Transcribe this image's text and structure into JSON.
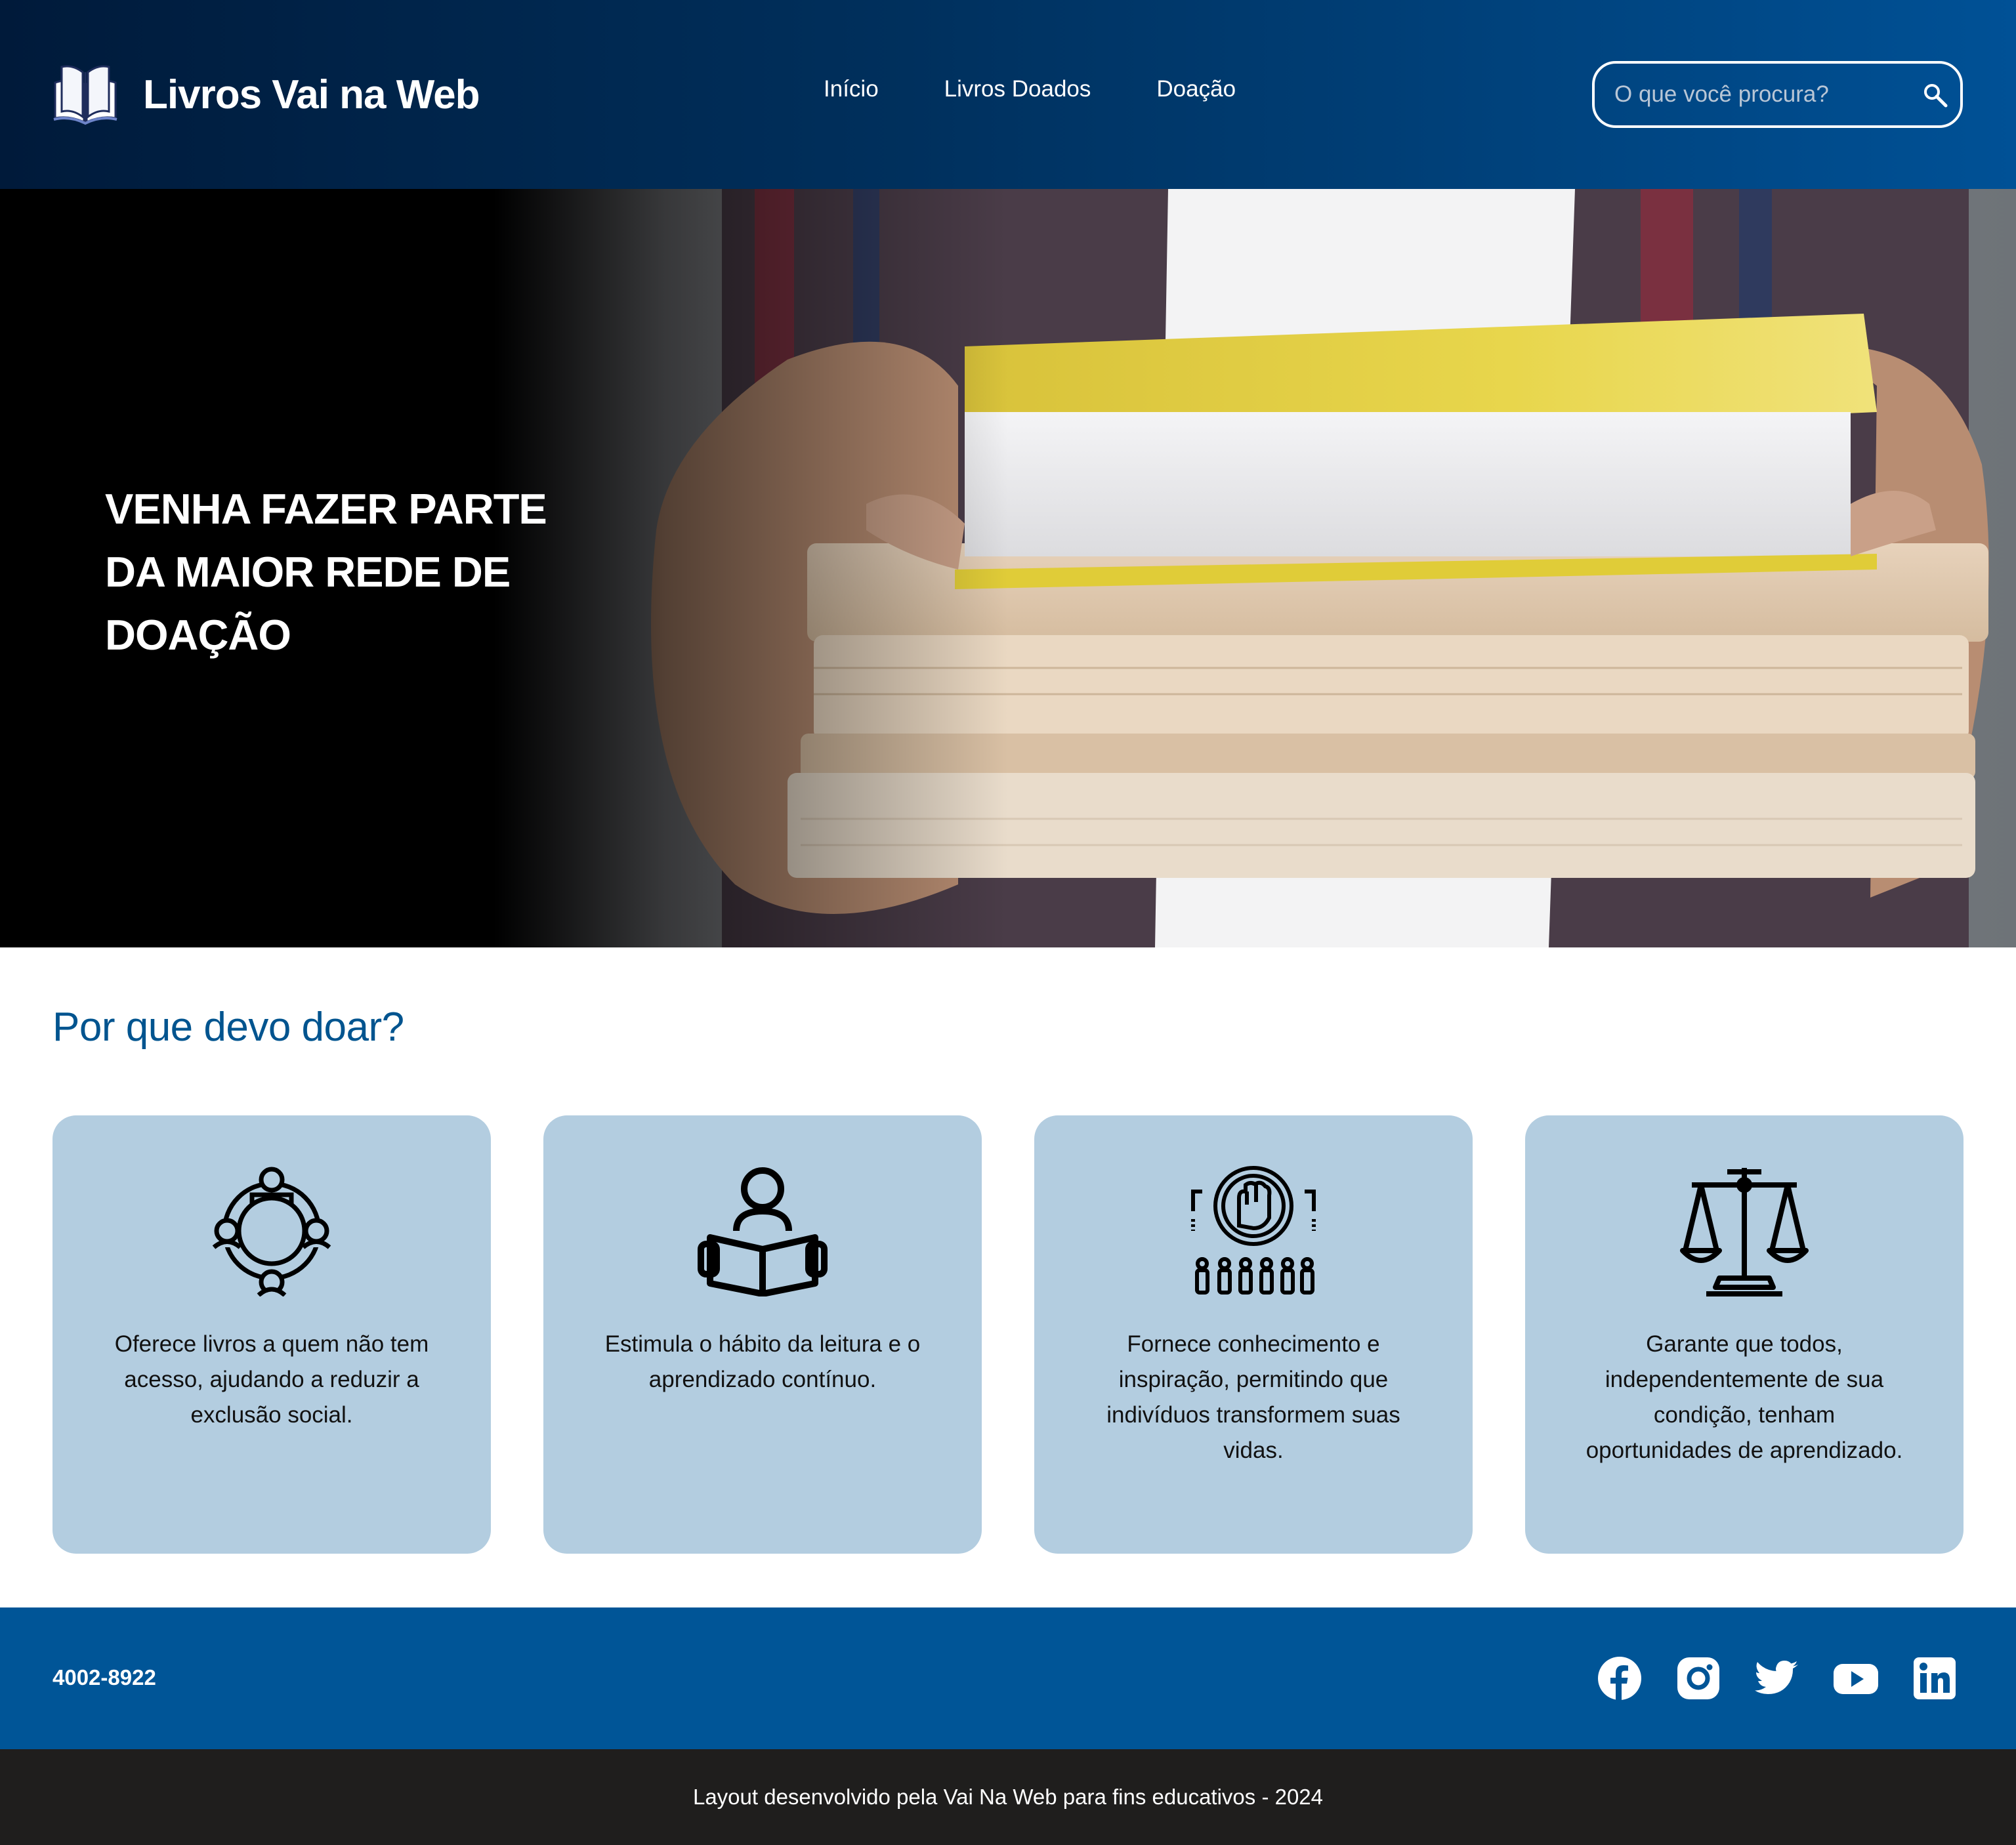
{
  "header": {
    "brand": "Livros Vai na Web",
    "nav": [
      "Início",
      "Livros Doados",
      "Doação"
    ],
    "search_placeholder": "O que você procura?"
  },
  "hero": {
    "line1": "VENHA FAZER PARTE",
    "line2": "DA MAIOR REDE DE",
    "line3": "DOAÇÃO"
  },
  "why": {
    "title": "Por que devo doar?",
    "cards": [
      {
        "icon": "community-circle-icon",
        "text": "Oferece livros a quem não tem acesso, ajudando a reduzir a exclusão social."
      },
      {
        "icon": "reader-book-icon",
        "text": "Estimula o hábito da leitura e o aprendizado contínuo."
      },
      {
        "icon": "raised-fist-people-icon",
        "text": "Fornece conhecimento e inspiração, permitindo que indivíduos transformem suas vidas."
      },
      {
        "icon": "justice-scale-icon",
        "text": "Garante que todos, independentemente de sua condição, tenham oportunidades de aprendizado."
      }
    ]
  },
  "footer": {
    "phone": "4002-8922",
    "socials": [
      "facebook-icon",
      "instagram-icon",
      "twitter-icon",
      "youtube-icon",
      "linkedin-icon"
    ],
    "credits": "Layout desenvolvido pela Vai Na Web para fins educativos - 2024"
  },
  "colors": {
    "header_gradient_start": "#001a3a",
    "header_gradient_end": "#005196",
    "accent_blue": "#00548f",
    "card_bg": "#b3cde0",
    "footer_blue": "#005597",
    "footer_dark": "#1f1e1d"
  }
}
